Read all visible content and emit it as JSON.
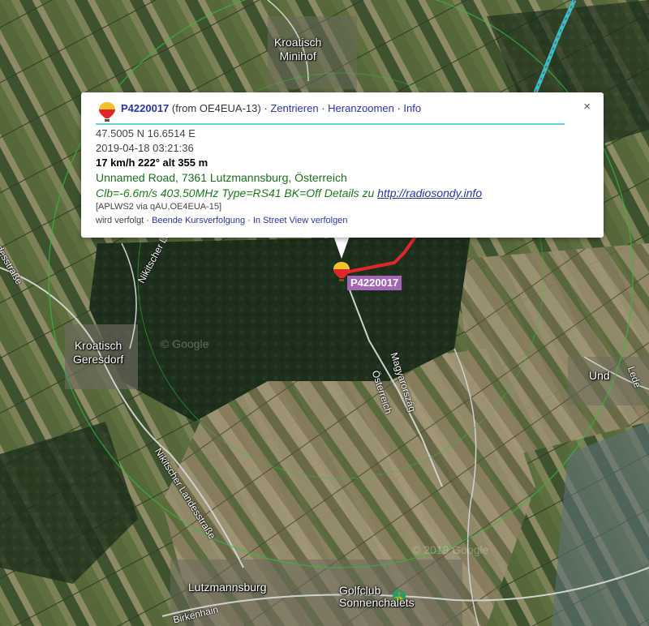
{
  "map": {
    "places": [
      {
        "name": "place-kroatisch-minihof",
        "text": "Kroatisch\nMinihof"
      },
      {
        "name": "place-kroatisch-geresdorf",
        "text": "Kroatisch\nGeresdorf"
      },
      {
        "name": "place-und",
        "text": "Und"
      },
      {
        "name": "place-lutzmannsburg",
        "text": "Lutzmannsburg"
      },
      {
        "name": "place-golfclub",
        "text": "Golfclub\nSonnenchalets"
      }
    ],
    "roads": [
      {
        "name": "road-magyarorszag",
        "text": "Magyarország"
      },
      {
        "name": "road-osterreich",
        "text": "Österreich"
      },
      {
        "name": "road-nikitscher-landesstrasse",
        "text": "Nikitscher Landesstraße"
      },
      {
        "name": "road-nikitscher-landesstrasse-2",
        "text": "Nikitscher La"
      },
      {
        "name": "road-landesstrasse-left",
        "text": "desstraße"
      },
      {
        "name": "road-birkenhain",
        "text": "Birkenhain"
      },
      {
        "name": "road-lede",
        "text": "Lede"
      }
    ],
    "watermark1": "© Google",
    "watermark2": "© 2019 Google"
  },
  "marker": {
    "label": "P4220017"
  },
  "popup": {
    "callsign": "P4220017",
    "from_text": "(from OE4EUA-13)",
    "separator": "·",
    "link_center": "Zentrieren",
    "link_zoom": "Heranzoomen",
    "link_info": "Info",
    "close": "×",
    "coordinates": "47.5005 N 16.6514 E",
    "timestamp": "2019-04-18 03:21:36",
    "speed": "17 km/h 222° alt 355 m",
    "address": "Unnamed Road, 7361 Lutzmannsburg, Österreich",
    "comment": "Clb=-6.6m/s 403.50MHz Type=RS41 BK=Off Details zu ",
    "comment_link": "http://radiosondy.info",
    "path": "[APLWS2 via qAU,OE4EUA-15]",
    "tracking": "wird verfolgt",
    "link_stop_tracking": "Beende Kursverfolgung",
    "link_streetview": "In Street View verfolgen"
  },
  "colors": {
    "track": "#e0262b",
    "accent_rule": "#62d3da",
    "link": "#2a33a8",
    "marker_label_bg": "#a466b4"
  }
}
